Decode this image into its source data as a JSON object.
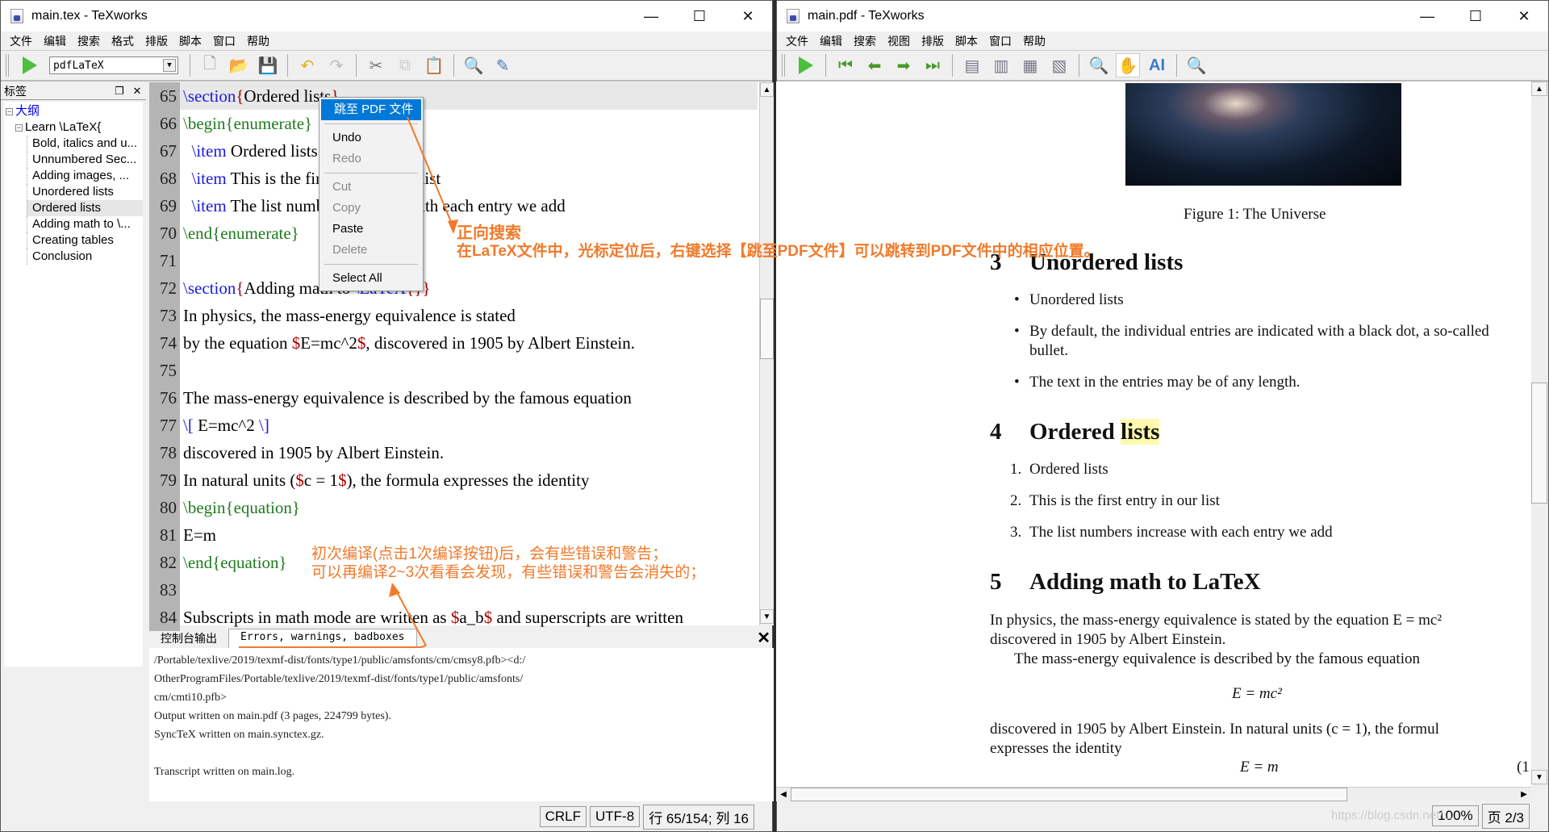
{
  "tex_window": {
    "title": "main.tex - TeXworks",
    "menu": [
      "文件",
      "编辑",
      "搜索",
      "格式",
      "排版",
      "脚本",
      "窗口",
      "帮助"
    ],
    "engine": "pdfLaTeX",
    "sidebar": {
      "title": "标签",
      "root": "大纲",
      "doc": "Learn \\LaTeX{",
      "items": [
        "Bold, italics and u...",
        "Unnumbered Sec...",
        "Adding images, ...",
        "Unordered lists",
        "Ordered lists",
        "Adding math to \\...",
        "Creating tables",
        "Conclusion"
      ],
      "selected": "Ordered lists"
    },
    "code_lines": [
      {
        "n": "65",
        "parts": [
          [
            "kw",
            "\\section"
          ],
          [
            "br",
            "{"
          ],
          [
            "",
            "Ordered lists"
          ],
          [
            "br",
            "}"
          ]
        ]
      },
      {
        "n": "66",
        "parts": [
          [
            "gr",
            "\\begin{enumerate}"
          ]
        ]
      },
      {
        "n": "67",
        "parts": [
          [
            "",
            "  "
          ],
          [
            "kw",
            "\\item"
          ],
          [
            "",
            " Ordered lists"
          ]
        ]
      },
      {
        "n": "68",
        "parts": [
          [
            "",
            "  "
          ],
          [
            "kw",
            "\\item"
          ],
          [
            "",
            " This is the first entry in our list"
          ]
        ]
      },
      {
        "n": "69",
        "parts": [
          [
            "",
            "  "
          ],
          [
            "kw",
            "\\item"
          ],
          [
            "",
            " The list numbers increase with each entry we add"
          ]
        ]
      },
      {
        "n": "70",
        "parts": [
          [
            "gr",
            "\\end{enumerate}"
          ]
        ]
      },
      {
        "n": "71",
        "parts": []
      },
      {
        "n": "72",
        "parts": [
          [
            "kw",
            "\\section"
          ],
          [
            "br",
            "{"
          ],
          [
            "",
            "Adding math to "
          ],
          [
            "kw",
            "\\LaTeX"
          ],
          [
            "br",
            "{}}"
          ]
        ]
      },
      {
        "n": "73",
        "parts": [
          [
            "",
            "In physics, the mass-energy equivalence is stated"
          ]
        ]
      },
      {
        "n": "74",
        "parts": [
          [
            "",
            "by the equation "
          ],
          [
            "dl",
            "$"
          ],
          [
            "",
            "E=mc^2"
          ],
          [
            "dl",
            "$"
          ],
          [
            "",
            ", discovered in 1905 by Albert Einstein."
          ]
        ]
      },
      {
        "n": "75",
        "parts": []
      },
      {
        "n": "76",
        "parts": [
          [
            "",
            "The mass-energy equivalence is described by the famous equation"
          ]
        ]
      },
      {
        "n": "77",
        "parts": [
          [
            "kw",
            "\\["
          ],
          [
            "",
            " E=mc^2 "
          ],
          [
            "kw",
            "\\]"
          ]
        ]
      },
      {
        "n": "78",
        "parts": [
          [
            "",
            "discovered in 1905 by Albert Einstein."
          ]
        ]
      },
      {
        "n": "79",
        "parts": [
          [
            "",
            "In natural units ("
          ],
          [
            "dl",
            "$"
          ],
          [
            "",
            "c = 1"
          ],
          [
            "dl",
            "$"
          ],
          [
            "",
            "), the formula expresses the identity"
          ]
        ]
      },
      {
        "n": "80",
        "parts": [
          [
            "gr",
            "\\begin{equation}"
          ]
        ]
      },
      {
        "n": "81",
        "parts": [
          [
            "",
            "E=m"
          ]
        ]
      },
      {
        "n": "82",
        "parts": [
          [
            "gr",
            "\\end{equation}"
          ]
        ]
      },
      {
        "n": "83",
        "parts": []
      },
      {
        "n": "84",
        "parts": [
          [
            "",
            "Subscripts in math mode are written as "
          ],
          [
            "dl",
            "$"
          ],
          [
            "",
            "a_b"
          ],
          [
            "dl",
            "$"
          ],
          [
            "",
            " and superscripts are written"
          ]
        ]
      }
    ],
    "context_menu": {
      "jump": "跳至 PDF 文件",
      "undo": "Undo",
      "redo": "Redo",
      "cut": "Cut",
      "copy": "Copy",
      "paste": "Paste",
      "delete": "Delete",
      "select_all": "Select All"
    },
    "console_tabs": [
      "控制台输出",
      "Errors, warnings, badboxes"
    ],
    "console_lines": [
      "/Portable/texlive/2019/texmf-dist/fonts/type1/public/amsfonts/cm/cmsy8.pfb><d:/",
      "OtherProgramFiles/Portable/texlive/2019/texmf-dist/fonts/type1/public/amsfonts/",
      "cm/cmti10.pfb>",
      "Output written on main.pdf (3 pages, 224799 bytes).",
      "SyncTeX written on main.synctex.gz.",
      "",
      "Transcript written on main.log."
    ],
    "status": {
      "eol": "CRLF",
      "enc": "UTF-8",
      "pos": "行 65/154; 列 16"
    }
  },
  "pdf_window": {
    "title": "main.pdf - TeXworks",
    "menu": [
      "文件",
      "编辑",
      "搜索",
      "视图",
      "排版",
      "脚本",
      "窗口",
      "帮助"
    ],
    "caption": "Figure 1: The Universe",
    "sec3": {
      "num": "3",
      "title": "Unordered lists",
      "items": [
        "Unordered lists",
        "By default, the individual entries are indicated with a black dot, a so-called",
        "bullet.",
        "The text in the entries may be of any length."
      ]
    },
    "sec4": {
      "num": "4",
      "title_a": "Ordered ",
      "title_b": "lists",
      "items": [
        "1.",
        "Ordered lists",
        "2.",
        "This is the first entry in our list",
        "3.",
        "The list numbers increase with each entry we add"
      ]
    },
    "sec5": {
      "num": "5",
      "title": "Adding math to LaTeX"
    },
    "para1": "In physics, the mass-energy equivalence is stated by the equation E = mc²",
    "para1b": "discovered in 1905 by Albert Einstein.",
    "para2": "The mass-energy equivalence is described by the famous equation",
    "eq1": "E = mc²",
    "para3": "discovered in 1905 by Albert Einstein.  In natural units (c = 1), the formul",
    "para3b": "expresses the identity",
    "eq2": "E = m",
    "eq2num": "(1",
    "status": {
      "zoom": "100%",
      "page": "页 2/3"
    },
    "watermark": "https://blog.csdn.net/..."
  },
  "annotations": {
    "forward_title": "正向搜索",
    "forward_desc": "在LaTeX文件中，光标定位后，右键选择【跳至PDF文件】可以跳转到PDF文件中的相应位置。",
    "compile_1": "初次编译(点击1次编译按钮)后，会有些错误和警告；",
    "compile_2": "可以再编译2~3次看看会发现，有些错误和警告会消失的；"
  }
}
